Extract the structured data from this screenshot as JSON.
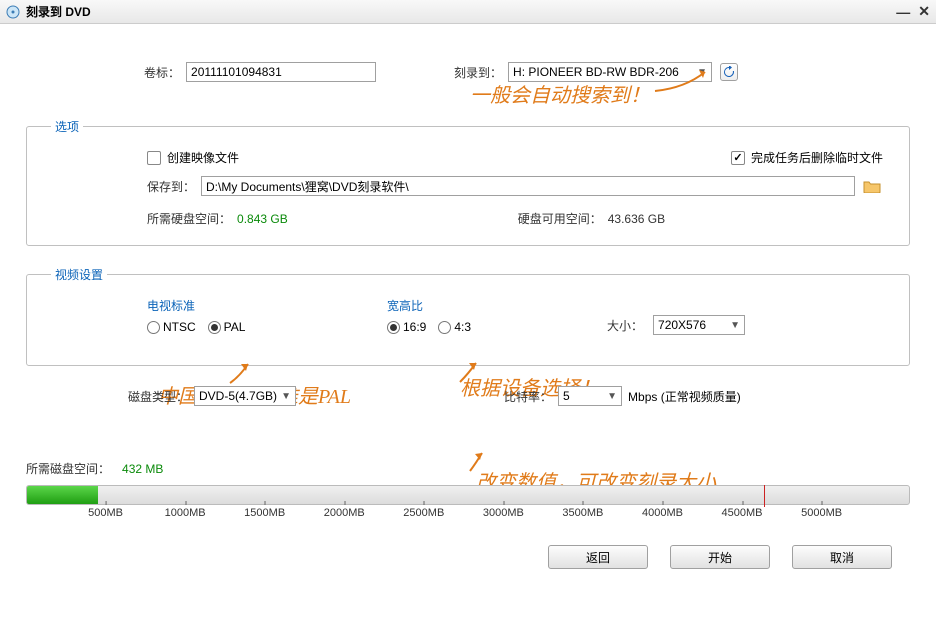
{
  "titlebar": {
    "title": "刻录到 DVD"
  },
  "top": {
    "volume_label": "卷标：",
    "volume_value": "20111101094831",
    "burn_to_label": "刻录到：",
    "burn_to_value": "H: PIONEER  BD-RW  BDR-206"
  },
  "options": {
    "legend": "选项",
    "create_image_label": "创建映像文件",
    "delete_temp_label": "完成任务后删除临时文件",
    "save_to_label": "保存到：",
    "save_to_path": "D:\\My Documents\\狸窝\\DVD刻录软件\\",
    "req_disk_label": "所需硬盘空间：",
    "req_disk_value": "0.843 GB",
    "avail_disk_label": "硬盘可用空间：",
    "avail_disk_value": "43.636 GB"
  },
  "video": {
    "legend": "视频设置",
    "tv_std_label": "电视标准",
    "ntsc": "NTSC",
    "pal": "PAL",
    "aspect_label": "宽高比",
    "r169": "16:9",
    "r43": "4:3",
    "size_label": "大小：",
    "size_value": "720X576"
  },
  "bottom": {
    "disc_type_label": "磁盘类型：",
    "disc_type_value": "DVD-5(4.7GB)",
    "bitrate_label": "比特率：",
    "bitrate_value": "5",
    "bitrate_unit": "Mbps (正常视频质量)"
  },
  "progress": {
    "req_label": "所需磁盘空间：",
    "req_value": "432 MB",
    "ticks": [
      "500MB",
      "1000MB",
      "1500MB",
      "2000MB",
      "2500MB",
      "3000MB",
      "3500MB",
      "4000MB",
      "4500MB",
      "5000MB"
    ]
  },
  "buttons": {
    "back": "返回",
    "start": "开始",
    "cancel": "取消"
  },
  "annotations": {
    "auto_search": "一般会自动搜索到！",
    "pal_note": "中国的视频标准是PAL",
    "aspect_note": "根据设备选择！",
    "bitrate_note": "改变数值，可改变刻录大小"
  }
}
